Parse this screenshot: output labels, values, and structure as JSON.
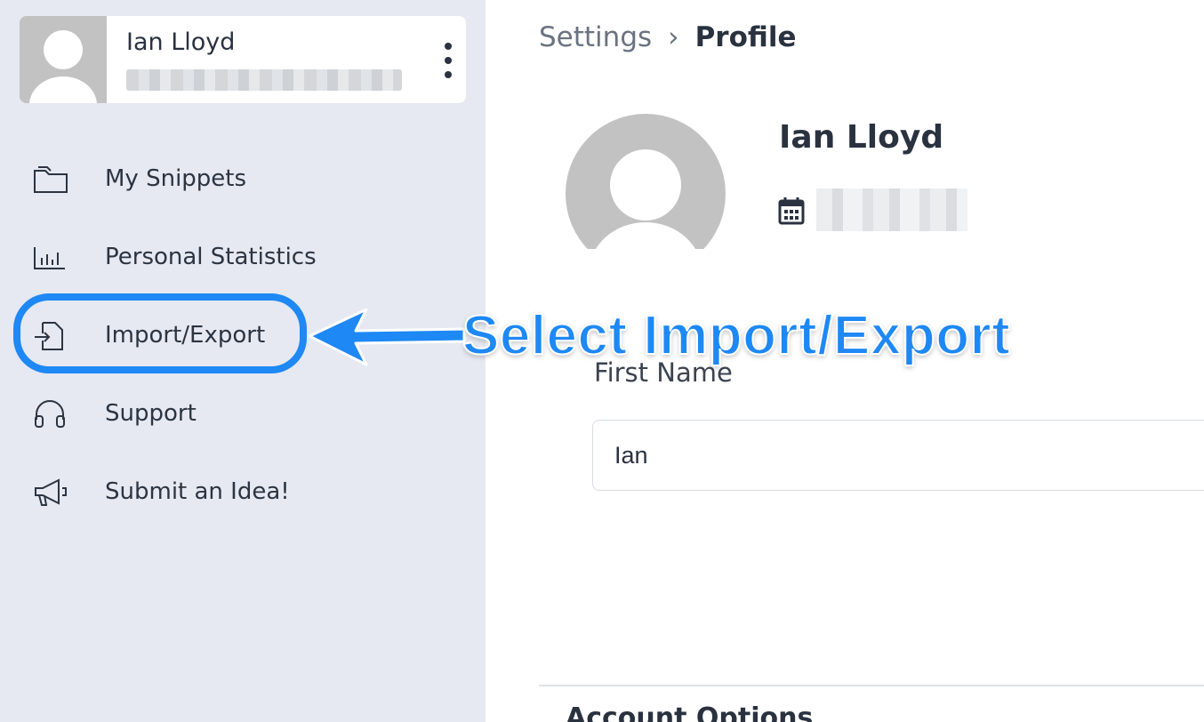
{
  "user": {
    "name": "Ian Lloyd"
  },
  "sidebar": {
    "items": [
      {
        "label": "My Snippets",
        "icon": "folder-icon"
      },
      {
        "label": "Personal Statistics",
        "icon": "bar-chart-icon"
      },
      {
        "label": "Import/Export",
        "icon": "file-import-icon"
      },
      {
        "label": "Support",
        "icon": "headphones-icon"
      },
      {
        "label": "Submit an Idea!",
        "icon": "megaphone-icon"
      }
    ]
  },
  "breadcrumb": {
    "root": "Settings",
    "separator": "›",
    "current": "Profile"
  },
  "profile": {
    "name": "Ian Lloyd",
    "first_name_label": "First Name",
    "first_name_value": "Ian",
    "account_section_title": "Account Options"
  },
  "annotation": {
    "text": "Select Import/Export",
    "color": "#1e88f5"
  },
  "colors": {
    "sidebar_bg": "#e6e9f1",
    "accent": "#1e88f5",
    "text": "#2c3442"
  }
}
